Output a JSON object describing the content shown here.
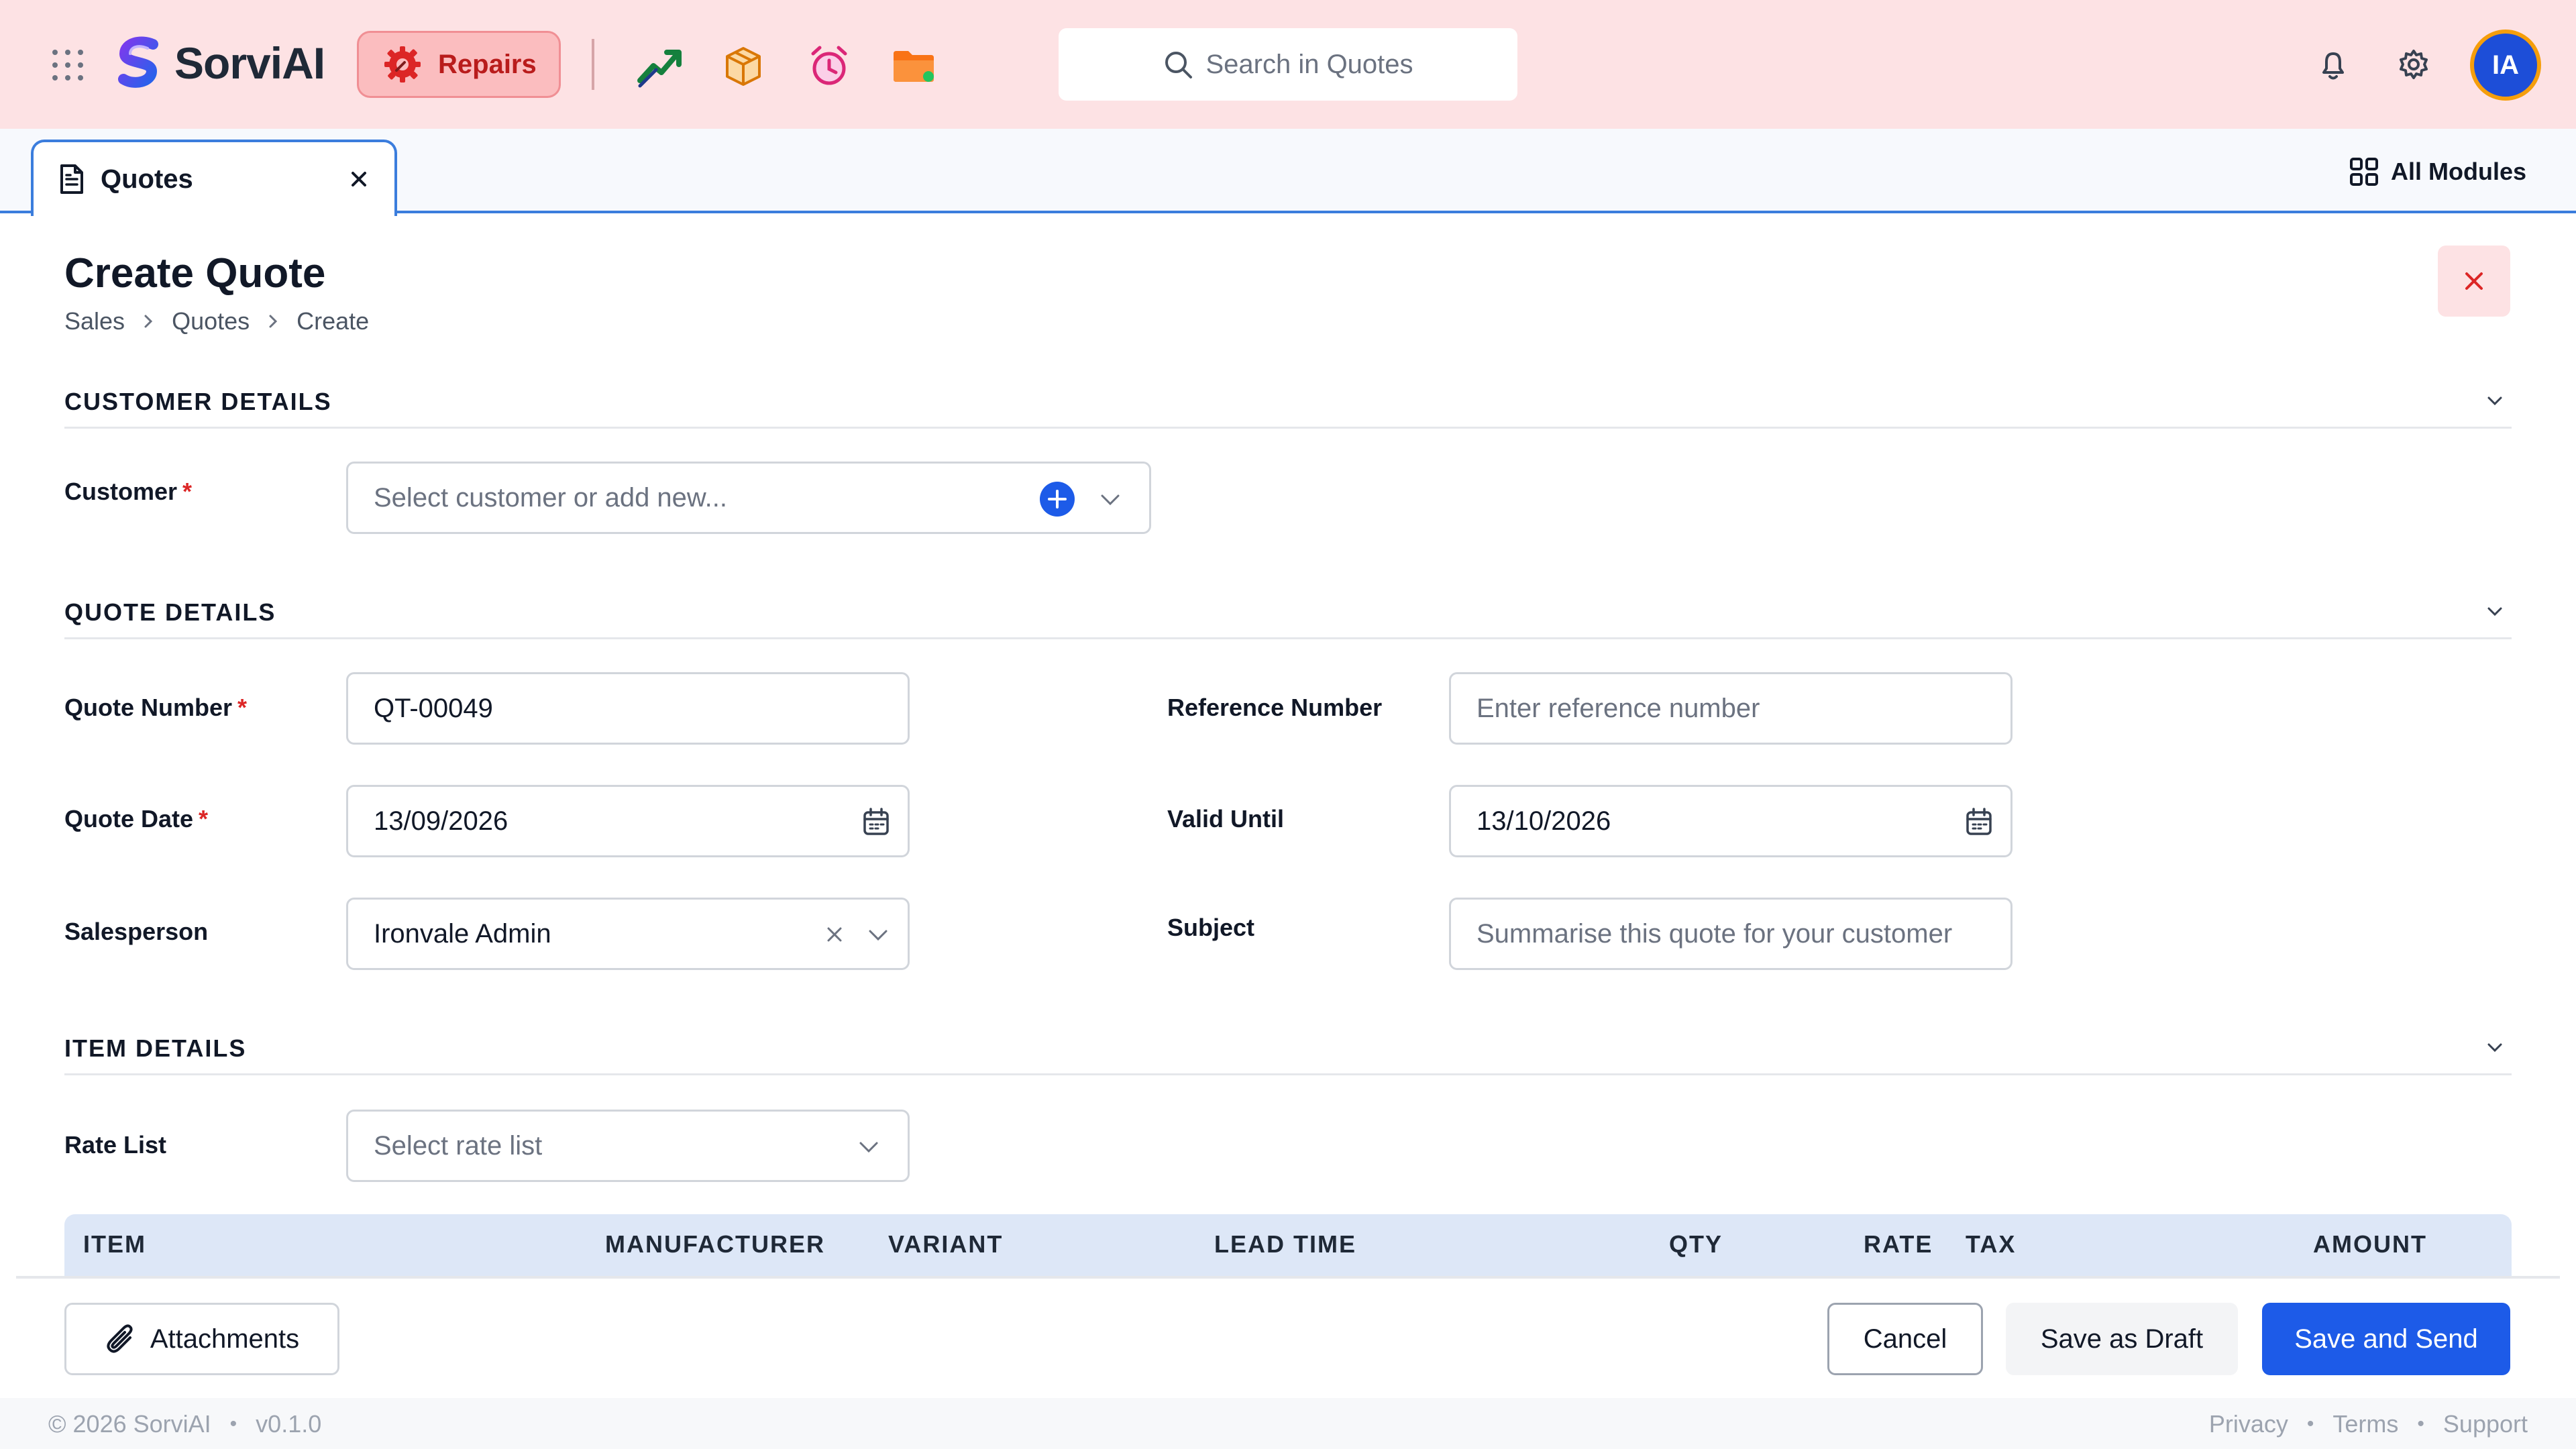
{
  "header": {
    "brand": "SorviAI",
    "module_label": "Repairs",
    "search_placeholder": "Search in Quotes",
    "avatar_initials": "IA",
    "app_icons": [
      "trending-up-icon",
      "package-icon",
      "alarm-clock-icon",
      "folder-icon"
    ]
  },
  "tabs": {
    "active_tab": "Quotes",
    "all_modules_label": "All Modules"
  },
  "page": {
    "title": "Create Quote",
    "breadcrumb": [
      "Sales",
      "Quotes",
      "Create"
    ]
  },
  "sections": {
    "customer": {
      "title": "CUSTOMER DETAILS",
      "customer_label": "Customer",
      "customer_placeholder": "Select customer or add new..."
    },
    "quote": {
      "title": "QUOTE DETAILS",
      "quote_number_label": "Quote Number",
      "quote_number_value": "QT-00049",
      "reference_label": "Reference Number",
      "reference_placeholder": "Enter reference number",
      "quote_date_label": "Quote Date",
      "quote_date_value": "13/09/2026",
      "valid_until_label": "Valid Until",
      "valid_until_value": "13/10/2026",
      "salesperson_label": "Salesperson",
      "salesperson_value": "Ironvale Admin",
      "subject_label": "Subject",
      "subject_placeholder": "Summarise this quote for your customer"
    },
    "items": {
      "title": "ITEM DETAILS",
      "rate_list_label": "Rate List",
      "rate_list_placeholder": "Select rate list",
      "columns": [
        "ITEM",
        "MANUFACTURER",
        "VARIANT",
        "LEAD TIME",
        "QTY",
        "RATE",
        "TAX",
        "AMOUNT"
      ]
    }
  },
  "actions": {
    "attachments": "Attachments",
    "cancel": "Cancel",
    "save_draft": "Save as Draft",
    "save_send": "Save and Send"
  },
  "footer": {
    "copyright": "© 2026 SorviAI",
    "version": "v0.1.0",
    "links": [
      "Privacy",
      "Terms",
      "Support"
    ]
  },
  "colors": {
    "header_bg": "#fde2e4",
    "primary": "#1d5be8",
    "required": "#dc2626",
    "tab_accent": "#3b7ddd"
  }
}
